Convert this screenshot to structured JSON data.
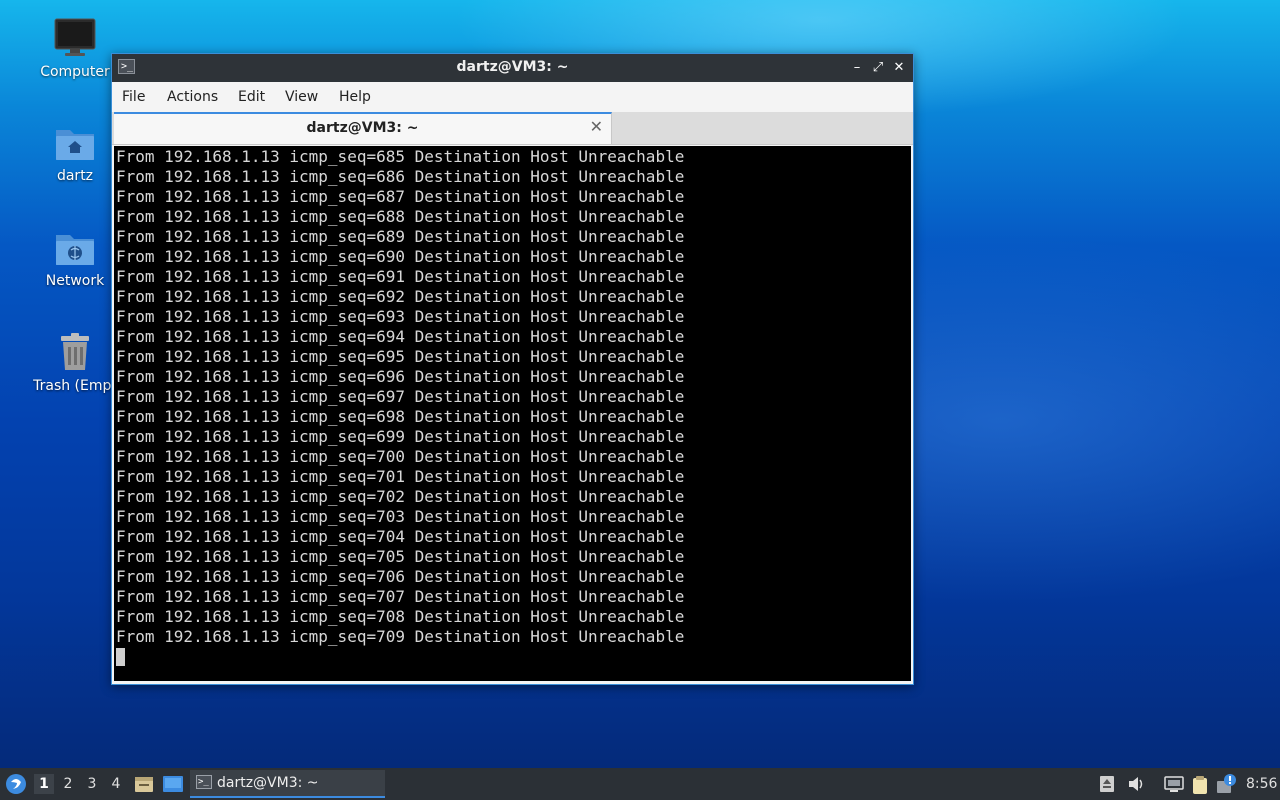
{
  "desktop": {
    "icons": [
      {
        "label": "Computer",
        "icon": "monitor-icon"
      },
      {
        "label": "dartz",
        "icon": "home-folder-icon"
      },
      {
        "label": "Network",
        "icon": "network-folder-icon"
      },
      {
        "label": "Trash (Empt",
        "icon": "trash-icon"
      }
    ]
  },
  "window": {
    "title": "dartz@VM3: ~",
    "controls": {
      "minimize": "–",
      "maximize": "⤢",
      "close": "✕"
    },
    "menu": [
      "File",
      "Actions",
      "Edit",
      "View",
      "Help"
    ],
    "tab": {
      "label": "dartz@VM3: ~",
      "close": "✕"
    }
  },
  "terminal": {
    "lines": [
      "From 192.168.1.13 icmp_seq=685 Destination Host Unreachable",
      "From 192.168.1.13 icmp_seq=686 Destination Host Unreachable",
      "From 192.168.1.13 icmp_seq=687 Destination Host Unreachable",
      "From 192.168.1.13 icmp_seq=688 Destination Host Unreachable",
      "From 192.168.1.13 icmp_seq=689 Destination Host Unreachable",
      "From 192.168.1.13 icmp_seq=690 Destination Host Unreachable",
      "From 192.168.1.13 icmp_seq=691 Destination Host Unreachable",
      "From 192.168.1.13 icmp_seq=692 Destination Host Unreachable",
      "From 192.168.1.13 icmp_seq=693 Destination Host Unreachable",
      "From 192.168.1.13 icmp_seq=694 Destination Host Unreachable",
      "From 192.168.1.13 icmp_seq=695 Destination Host Unreachable",
      "From 192.168.1.13 icmp_seq=696 Destination Host Unreachable",
      "From 192.168.1.13 icmp_seq=697 Destination Host Unreachable",
      "From 192.168.1.13 icmp_seq=698 Destination Host Unreachable",
      "From 192.168.1.13 icmp_seq=699 Destination Host Unreachable",
      "From 192.168.1.13 icmp_seq=700 Destination Host Unreachable",
      "From 192.168.1.13 icmp_seq=701 Destination Host Unreachable",
      "From 192.168.1.13 icmp_seq=702 Destination Host Unreachable",
      "From 192.168.1.13 icmp_seq=703 Destination Host Unreachable",
      "From 192.168.1.13 icmp_seq=704 Destination Host Unreachable",
      "From 192.168.1.13 icmp_seq=705 Destination Host Unreachable",
      "From 192.168.1.13 icmp_seq=706 Destination Host Unreachable",
      "From 192.168.1.13 icmp_seq=707 Destination Host Unreachable",
      "From 192.168.1.13 icmp_seq=708 Destination Host Unreachable",
      "From 192.168.1.13 icmp_seq=709 Destination Host Unreachable"
    ]
  },
  "taskbar": {
    "workspaces": [
      "1",
      "2",
      "3",
      "4"
    ],
    "active_workspace": "1",
    "task": {
      "label": "dartz@VM3: ~"
    },
    "clock": "8:56"
  },
  "colors": {
    "accent": "#3c8be0",
    "titlebar": "#2e3338",
    "terminal_bg": "#000000",
    "terminal_fg": "#d8d8d8",
    "taskbar": "#2b3036"
  }
}
